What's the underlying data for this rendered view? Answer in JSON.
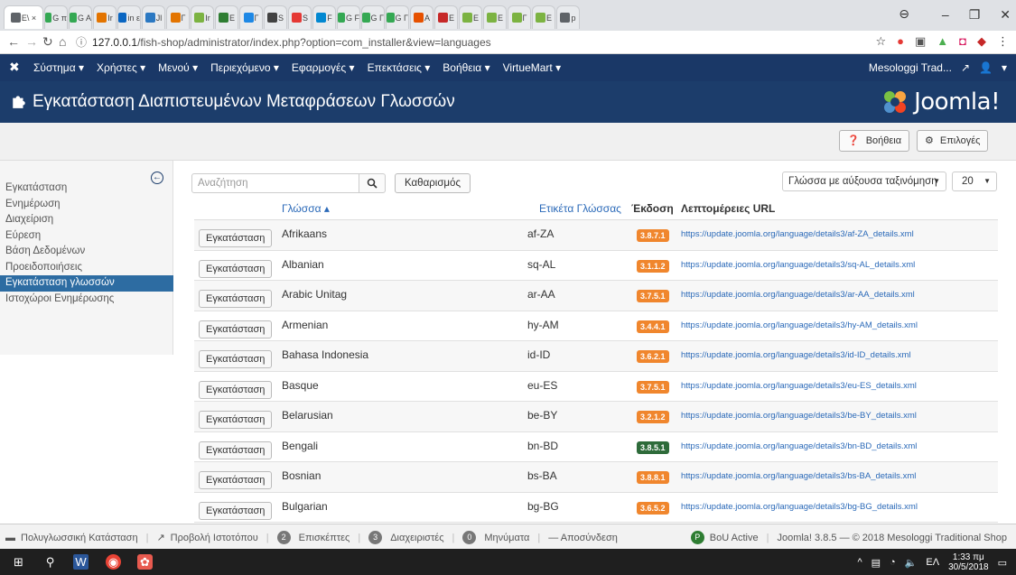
{
  "browser": {
    "tabs": [
      {
        "label": "Ε\\ ×",
        "color": "#5f6368"
      },
      {
        "label": "G π",
        "color": "#34a853"
      },
      {
        "label": "G A",
        "color": "#34a853"
      },
      {
        "label": "Ir",
        "color": "#e37400"
      },
      {
        "label": "in ε",
        "color": "#0a66c2"
      },
      {
        "label": "Jl",
        "color": "#2b78c2"
      },
      {
        "label": "Γ",
        "color": "#e37400"
      },
      {
        "label": "Ir",
        "color": "#7cb342"
      },
      {
        "label": "E",
        "color": "#2e7d32"
      },
      {
        "label": "Γ",
        "color": "#1e88e5"
      },
      {
        "label": "S",
        "color": "#424242"
      },
      {
        "label": "S",
        "color": "#e53935"
      },
      {
        "label": "F",
        "color": "#0288d1"
      },
      {
        "label": "G F",
        "color": "#34a853"
      },
      {
        "label": "G Γ",
        "color": "#34a853"
      },
      {
        "label": "G Γ",
        "color": "#34a853"
      },
      {
        "label": "A",
        "color": "#e65100"
      },
      {
        "label": "E",
        "color": "#c62828"
      },
      {
        "label": "E",
        "color": "#7cb342"
      },
      {
        "label": "E",
        "color": "#7cb342"
      },
      {
        "label": "Γ",
        "color": "#7cb342"
      },
      {
        "label": "E",
        "color": "#7cb342"
      },
      {
        "label": "p",
        "color": "#5f6368"
      }
    ],
    "url_prefix": "127.0.0.1",
    "url_path": "/fish-shop/administrator/index.php?option=com_installer&view=languages",
    "info_icon": "ⓘ"
  },
  "adminnav": {
    "menu": [
      {
        "label": "Σύστημα ▾"
      },
      {
        "label": "Χρήστες ▾"
      },
      {
        "label": "Μενού ▾"
      },
      {
        "label": "Περιεχόμενο ▾"
      },
      {
        "label": "Εφαρμογές ▾"
      },
      {
        "label": "Επεκτάσεις ▾"
      },
      {
        "label": "Βοήθεια ▾"
      },
      {
        "label": "VirtueMart ▾"
      }
    ],
    "site_name": "Mesologgi Trad...",
    "user_label": "▾"
  },
  "header": {
    "title": "Εγκατάσταση Διαπιστευμένων Μεταφράσεων Γλωσσών",
    "logo_text": "Joomla!"
  },
  "toolbar": {
    "help_label": "Βοήθεια",
    "options_label": "Επιλογές"
  },
  "sidebar": {
    "items": [
      {
        "label": "Εγκατάσταση"
      },
      {
        "label": "Ενημέρωση"
      },
      {
        "label": "Διαχείριση"
      },
      {
        "label": "Εύρεση"
      },
      {
        "label": "Βάση Δεδομένων"
      },
      {
        "label": "Προειδοποιήσεις"
      },
      {
        "label": "Εγκατάσταση γλωσσών"
      },
      {
        "label": "Ιστοχώροι Ενημέρωσης"
      }
    ],
    "active_index": 6
  },
  "filters": {
    "search_placeholder": "Αναζήτηση",
    "clear_label": "Καθαρισμός",
    "sort_value": "Γλώσσα με αύξουσα ταξινόμηση",
    "limit_value": "20"
  },
  "table": {
    "columns": {
      "language": "Γλώσσα ▴",
      "tag": "Ετικέτα Γλώσσας",
      "version": "Έκδοση",
      "url": "Λεπτομέρειες URL"
    },
    "install_label": "Εγκατάσταση",
    "rows": [
      {
        "name": "Afrikaans",
        "tag": "af-ZA",
        "version": "3.8.7.1",
        "badge_color": "#f0862d",
        "url": "https://update.joomla.org/language/details3/af-ZA_details.xml"
      },
      {
        "name": "Albanian",
        "tag": "sq-AL",
        "version": "3.1.1.2",
        "badge_color": "#f0862d",
        "url": "https://update.joomla.org/language/details3/sq-AL_details.xml"
      },
      {
        "name": "Arabic Unitag",
        "tag": "ar-AA",
        "version": "3.7.5.1",
        "badge_color": "#f0862d",
        "url": "https://update.joomla.org/language/details3/ar-AA_details.xml"
      },
      {
        "name": "Armenian",
        "tag": "hy-AM",
        "version": "3.4.4.1",
        "badge_color": "#f0862d",
        "url": "https://update.joomla.org/language/details3/hy-AM_details.xml"
      },
      {
        "name": "Bahasa Indonesia",
        "tag": "id-ID",
        "version": "3.6.2.1",
        "badge_color": "#f0862d",
        "url": "https://update.joomla.org/language/details3/id-ID_details.xml"
      },
      {
        "name": "Basque",
        "tag": "eu-ES",
        "version": "3.7.5.1",
        "badge_color": "#f0862d",
        "url": "https://update.joomla.org/language/details3/eu-ES_details.xml"
      },
      {
        "name": "Belarusian",
        "tag": "be-BY",
        "version": "3.2.1.2",
        "badge_color": "#f0862d",
        "url": "https://update.joomla.org/language/details3/be-BY_details.xml"
      },
      {
        "name": "Bengali",
        "tag": "bn-BD",
        "version": "3.8.5.1",
        "badge_color": "#2e6b3a",
        "url": "https://update.joomla.org/language/details3/bn-BD_details.xml"
      },
      {
        "name": "Bosnian",
        "tag": "bs-BA",
        "version": "3.8.8.1",
        "badge_color": "#f0862d",
        "url": "https://update.joomla.org/language/details3/bs-BA_details.xml"
      },
      {
        "name": "Bulgarian",
        "tag": "bg-BG",
        "version": "3.6.5.2",
        "badge_color": "#f0862d",
        "url": "https://update.joomla.org/language/details3/bg-BG_details.xml"
      }
    ]
  },
  "statusbar": {
    "multilang": "Πολυγλωσσική Κατάσταση",
    "view_site": "Προβολή Ιστοτόπου",
    "visitors_count": "2",
    "visitors_label": "Επισκέπτες",
    "admins_count": "3",
    "admins_label": "Διαχειριστές",
    "messages_count": "0",
    "messages_label": "Μηνύματα",
    "logout": "— Αποσύνδεση",
    "bou_label": "BoU Active",
    "copyright": "Joomla! 3.8.5 — © 2018 Mesologgi Traditional Shop"
  },
  "taskbar": {
    "lang": "ΕΛ",
    "time": "1:33 πμ",
    "date": "30/5/2018"
  }
}
